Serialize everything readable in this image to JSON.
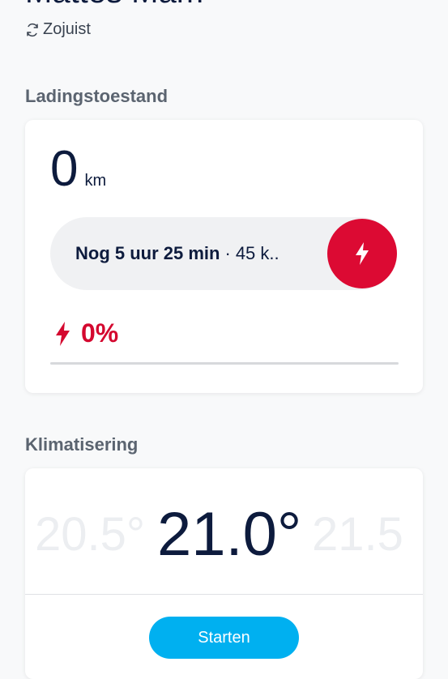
{
  "header": {
    "title": "Mattes Mam",
    "refresh_label": "Zojuist"
  },
  "charging": {
    "section_title": "Ladingstoestand",
    "range_value": "0",
    "range_unit": "km",
    "time_remaining": "Nog 5 uur 25 min",
    "separator": "·",
    "power_text": "45 k..",
    "percent": "0%",
    "progress_fraction": 0.0,
    "accent_color": "#dc0a33"
  },
  "climate": {
    "section_title": "Klimatisering",
    "temp_prev": "20.5°",
    "temp_current": "21.0°",
    "temp_next": "21.5",
    "start_label": "Starten",
    "button_color": "#00b0f0"
  }
}
